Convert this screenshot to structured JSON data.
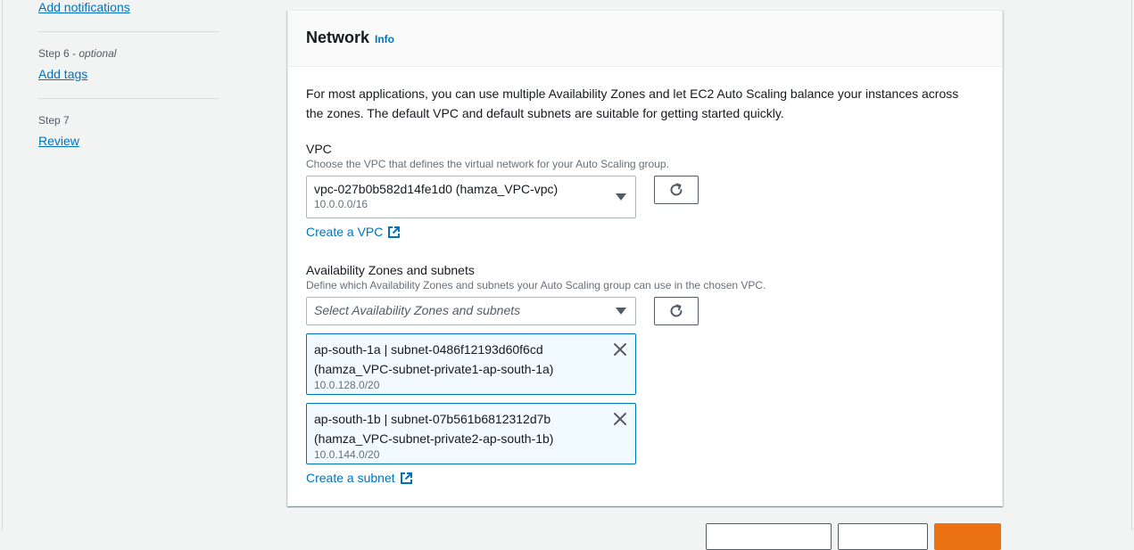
{
  "nav": {
    "steps": [
      {
        "link": "Add notifications"
      },
      {
        "step": "Step 6",
        "sep": " - ",
        "optional": "optional",
        "link": "Add tags"
      },
      {
        "step": "Step 7",
        "link": "Review"
      }
    ]
  },
  "network": {
    "title": "Network",
    "info": "Info",
    "description": "For most applications, you can use multiple Availability Zones and let EC2 Auto Scaling balance your instances across the zones. The default VPC and default subnets are suitable for getting started quickly.",
    "vpc": {
      "label": "VPC",
      "description": "Choose the VPC that defines the virtual network for your Auto Scaling group.",
      "selected": "vpc-027b0b582d14fe1d0 (hamza_VPC-vpc)",
      "cidr": "10.0.0.0/16",
      "create_link": "Create a VPC"
    },
    "az": {
      "label": "Availability Zones and subnets",
      "description": "Define which Availability Zones and subnets your Auto Scaling group can use in the chosen VPC.",
      "placeholder": "Select Availability Zones and subnets",
      "tokens": [
        {
          "line1": "ap-south-1a | subnet-0486f12193d60f6cd",
          "line2": "(hamza_VPC-subnet-private1-ap-south-1a)",
          "cidr": "10.0.128.0/20"
        },
        {
          "line1": "ap-south-1b | subnet-07b561b6812312d7b",
          "line2": "(hamza_VPC-subnet-private2-ap-south-1b)",
          "cidr": "10.0.144.0/20"
        }
      ],
      "create_link": "Create a subnet"
    }
  },
  "colors": {
    "link": "#0073bb",
    "token_bg": "#f1faff",
    "primary": "#ec7211"
  }
}
